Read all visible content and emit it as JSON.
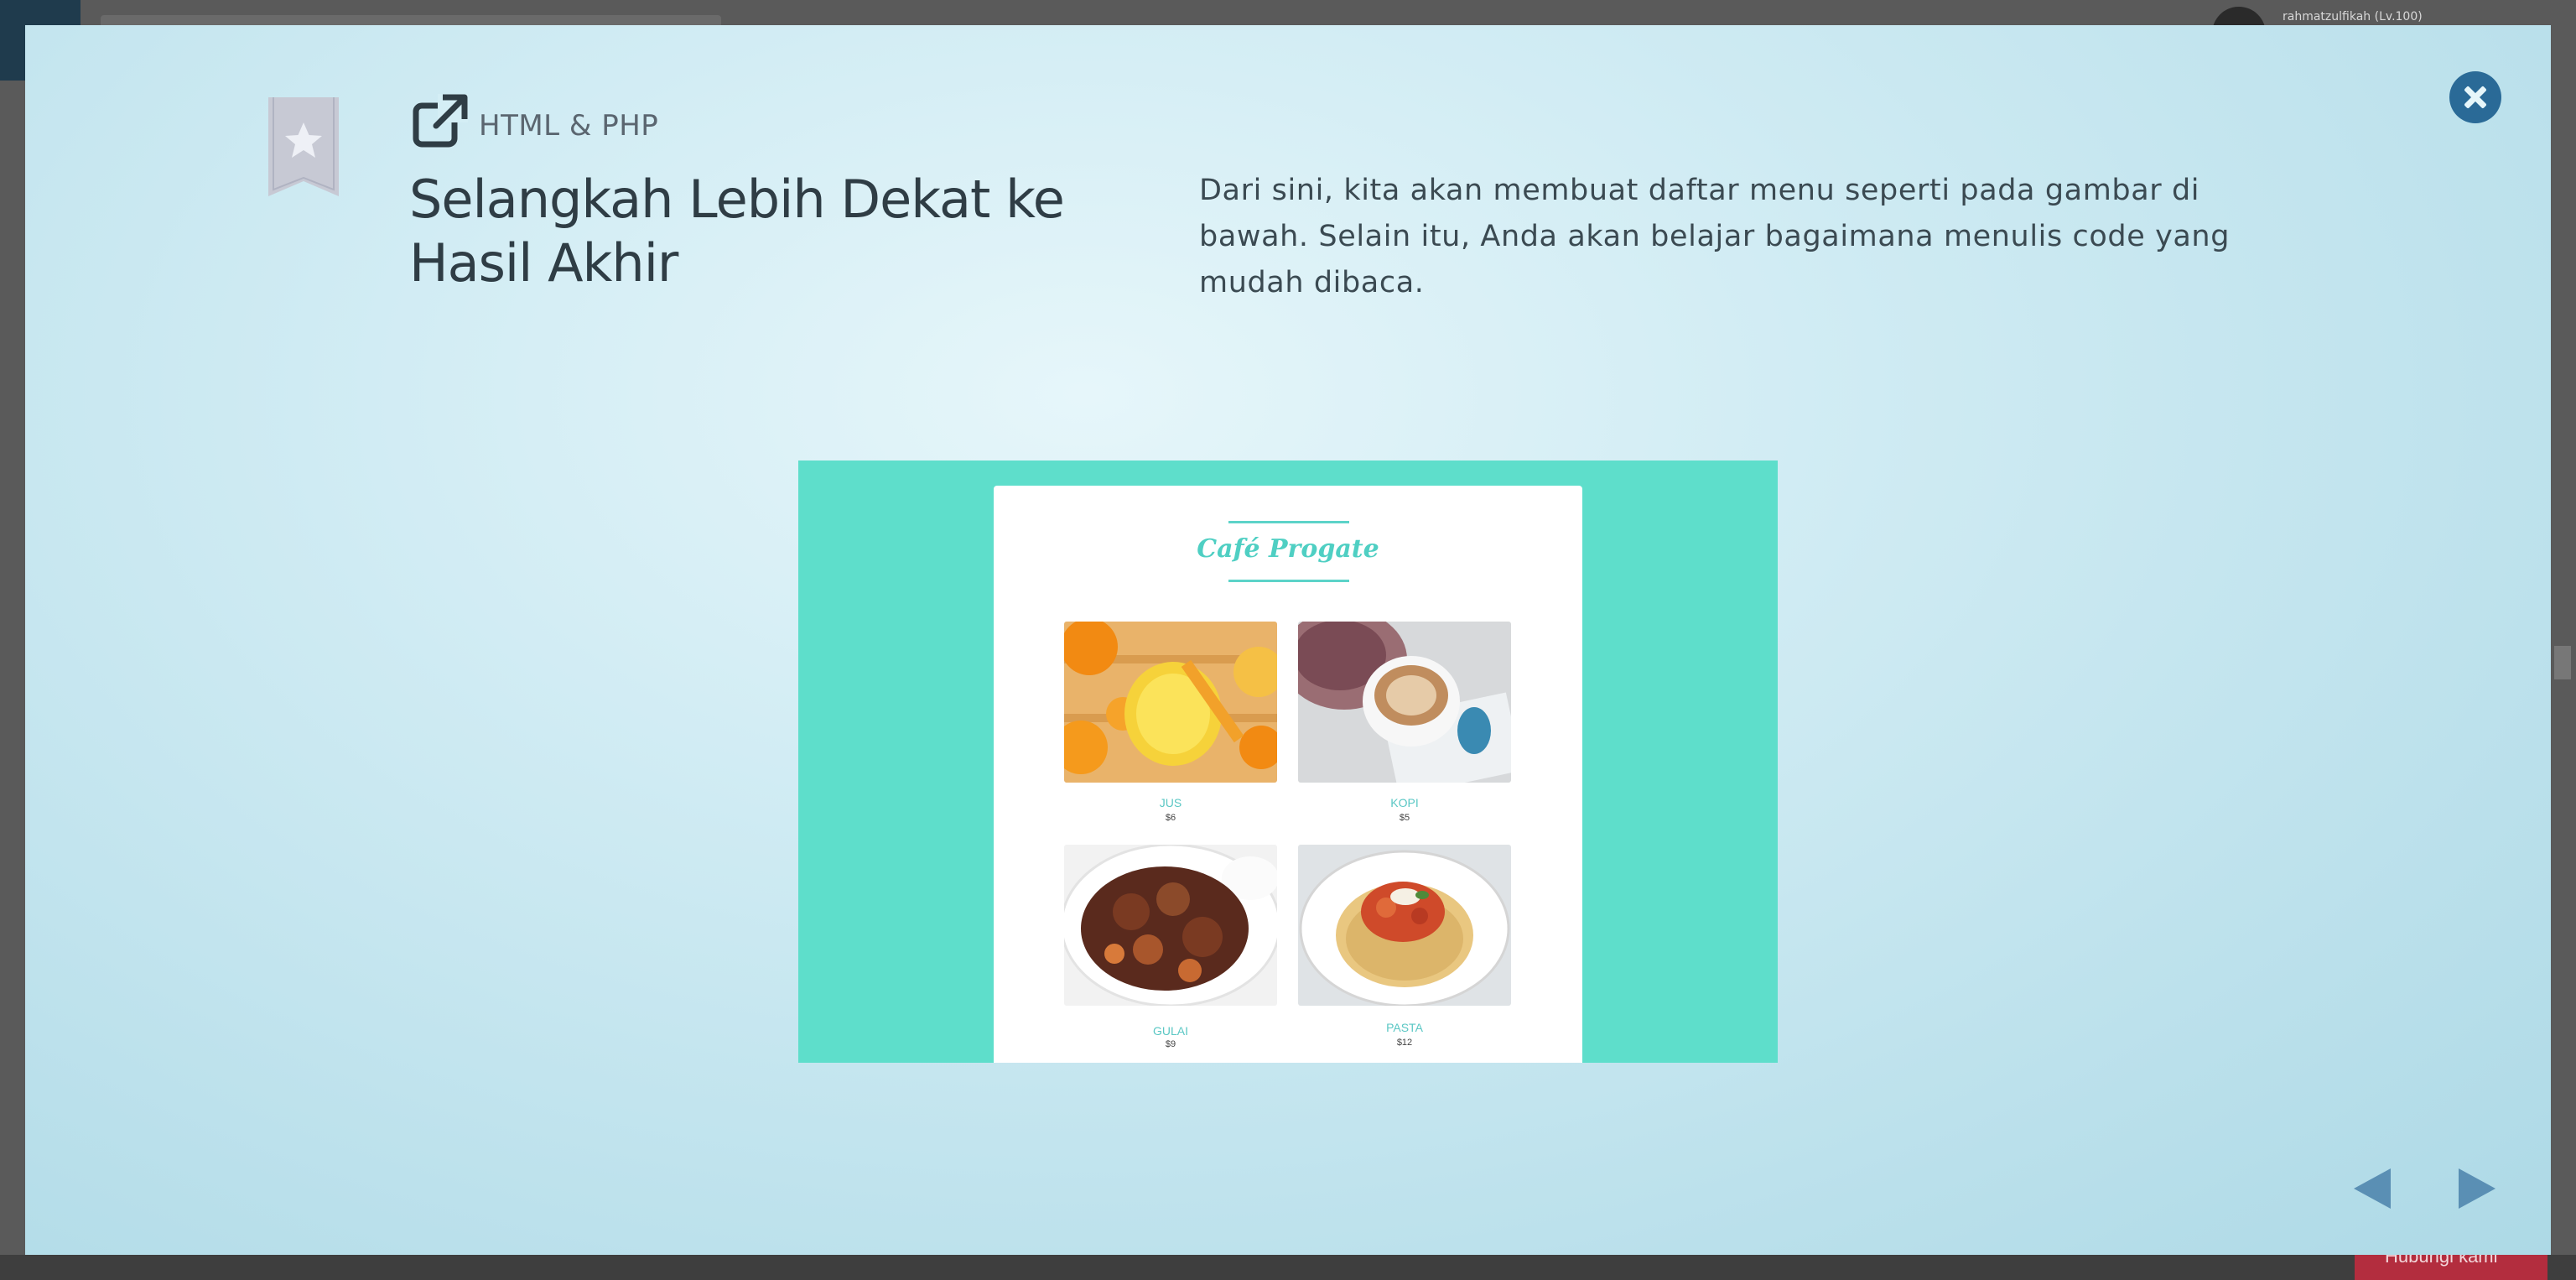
{
  "background": {
    "username": "rahmatzulfikah (Lv.100)",
    "help_button": "Hubungi kami"
  },
  "lesson": {
    "category": "HTML & PHP",
    "title": "Selangkah Lebih Dekat ke Hasil Akhir",
    "description": "Dari sini, kita akan membuat daftar menu seperti pada gambar di bawah. Selain itu, Anda akan belajar bagaimana menulis code yang mudah dibaca."
  },
  "preview": {
    "cafe_name": "Café Progate",
    "items": [
      {
        "name": "JUS",
        "price": "$6"
      },
      {
        "name": "KOPI",
        "price": "$5"
      },
      {
        "name": "GULAI",
        "price": "$9"
      },
      {
        "name": "PASTA",
        "price": "$12"
      }
    ]
  },
  "icons": {
    "close": "close-icon",
    "bookmark": "star-bookmark-icon",
    "external": "external-link-icon",
    "prev": "arrow-left-icon",
    "next": "arrow-right-icon"
  },
  "colors": {
    "accent": "#2a6a97",
    "preview_bg": "#5edecb",
    "nav_arrow": "#5a8fb4"
  }
}
